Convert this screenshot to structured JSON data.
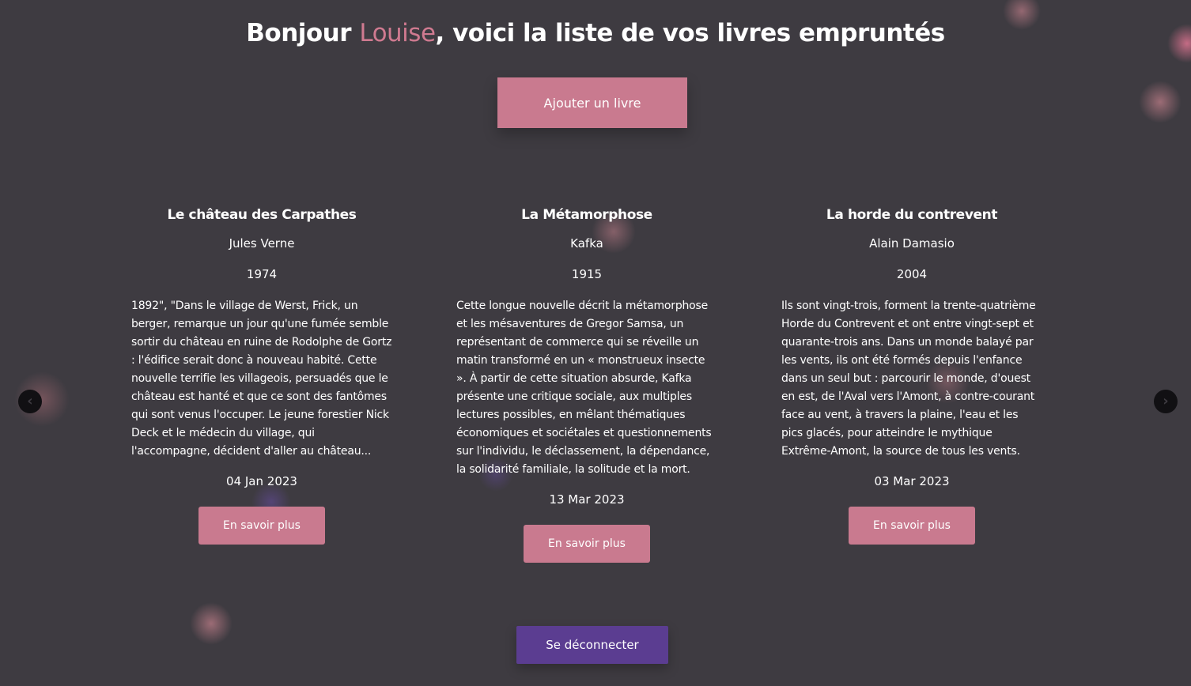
{
  "header": {
    "greeting": "Bonjour ",
    "user_name": "Louise",
    "suffix": ", voici la liste de vos livres empruntés"
  },
  "actions": {
    "add_book_label": "Ajouter un livre",
    "logout_label": "Se déconnecter"
  },
  "carousel": {
    "prev_icon": "chevron-left-icon",
    "next_icon": "chevron-right-icon",
    "prev_glyph": "‹",
    "next_glyph": "›"
  },
  "books": [
    {
      "title": "Le château des Carpathes",
      "author": "Jules Verne",
      "year": "1974",
      "description": "1892\", \"Dans le village de Werst, Frick, un berger, remarque un jour qu'une fumée semble sortir du château en ruine de Rodolphe de Gortz : l'édifice serait donc à nouveau habité. Cette nouvelle terrifie les villageois, persuadés que le château est hanté et que ce sont des fantômes qui sont venus l'occuper. Le jeune forestier Nick Deck et le médecin du village, qui l'accompagne, décident d'aller au château...",
      "date": "04 Jan 2023",
      "more_label": "En savoir plus"
    },
    {
      "title": "La Métamorphose",
      "author": "Kafka",
      "year": "1915",
      "description": "Cette longue nouvelle décrit la métamorphose et les mésaventures de Gregor Samsa, un représentant de commerce qui se réveille un matin transformé en un « monstrueux insecte ». À partir de cette situation absurde, Kafka présente une critique sociale, aux multiples lectures possibles, en mêlant thématiques économiques et sociétales et questionnements sur l'individu, le déclassement, la dépendance, la solidarité familiale, la solitude et la mort.",
      "date": "13 Mar 2023",
      "more_label": "En savoir plus"
    },
    {
      "title": "La horde du contrevent",
      "author": "Alain Damasio",
      "year": "2004",
      "description": "Ils sont vingt-trois, forment la trente-quatrième Horde du Contrevent et ont entre vingt-sept et quarante-trois ans. Dans un monde balayé par les vents, ils ont été formés depuis l'enfance dans un seul but : parcourir le monde, d'ouest en est, de l'Aval vers l'Amont, à contre-courant face au vent, à travers la plaine, l'eau et les pics glacés, pour atteindre le mythique Extrême-Amont, la source de tous les vents.",
      "date": "03 Mar 2023",
      "more_label": "En savoir plus"
    }
  ],
  "colors": {
    "background": "#3e3b41",
    "accent_pink": "#c97a8f",
    "name_pink": "#cf7a90",
    "logout_purple": "#5b3d91"
  }
}
